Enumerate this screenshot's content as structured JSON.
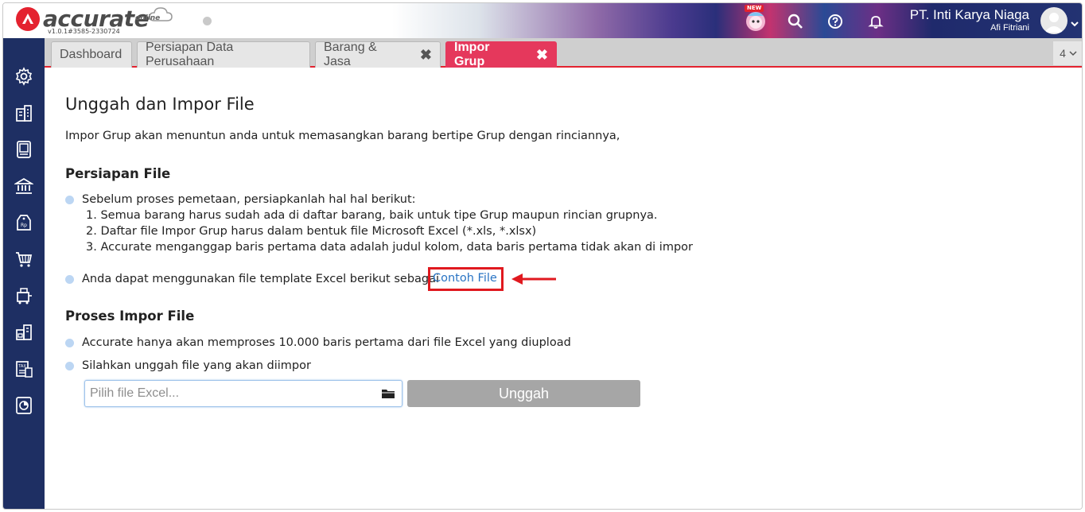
{
  "app": {
    "brand": "accurate",
    "brand_suffix": "online",
    "version": "v1.0.1#3585-2330724",
    "new_badge": "NEW"
  },
  "header": {
    "company_name": "PT. Inti Karya Niaga",
    "user_name": "Afi Fitriani",
    "icons": [
      "search-icon",
      "help-icon",
      "bell-icon",
      "avatar",
      "chevron-down-icon"
    ]
  },
  "sidebar": {
    "items": [
      {
        "icon": "gear-icon"
      },
      {
        "icon": "building-icon"
      },
      {
        "icon": "book-icon"
      },
      {
        "icon": "bank-icon"
      },
      {
        "icon": "price-tag-icon"
      },
      {
        "icon": "cart-icon"
      },
      {
        "icon": "purchase-icon"
      },
      {
        "icon": "warehouse-icon"
      },
      {
        "icon": "tax-icon"
      },
      {
        "icon": "report-icon"
      }
    ]
  },
  "tabs": [
    {
      "label": "Dashboard",
      "closable": false,
      "active": false
    },
    {
      "label": "Persiapan Data Perusahaan",
      "closable": false,
      "active": false
    },
    {
      "label": "Barang & Jasa",
      "closable": true,
      "active": false
    },
    {
      "label": "Impor Grup",
      "closable": true,
      "active": true
    }
  ],
  "tab_count": "4",
  "main": {
    "title": "Unggah dan Impor File",
    "intro": "Impor Grup akan menuntun anda untuk memasangkan barang bertipe Grup dengan rinciannya,",
    "prep": {
      "title": "Persiapan File",
      "bullet1": "Sebelum proses pemetaan, persiapkanlah hal hal berikut:",
      "steps": [
        "1. Semua barang harus sudah ada di daftar barang, baik untuk tipe Grup maupun rincian grupnya.",
        "2. Daftar file Impor Grup harus dalam bentuk file Microsoft Excel (*.xls, *.xlsx)",
        "3. Accurate menganggap baris pertama data adalah judul kolom, data baris pertama tidak akan di impor"
      ],
      "bullet2": "Anda dapat menggunakan file template Excel berikut sebagai",
      "sample_link": "Contoh File"
    },
    "process": {
      "title": "Proses Impor File",
      "bullet1": "Accurate hanya akan memproses 10.000 baris pertama dari file Excel yang diupload",
      "bullet2": "Silahkan unggah file yang akan diimpor"
    },
    "file_input": {
      "placeholder": "Pilih file Excel..."
    },
    "upload_label": "Unggah"
  },
  "colors": {
    "brand_red": "#e4222f",
    "active_tab": "#e5385c",
    "sidebar": "#1e2f63",
    "link": "#2a74c4",
    "highlight_box": "#e0191f"
  }
}
